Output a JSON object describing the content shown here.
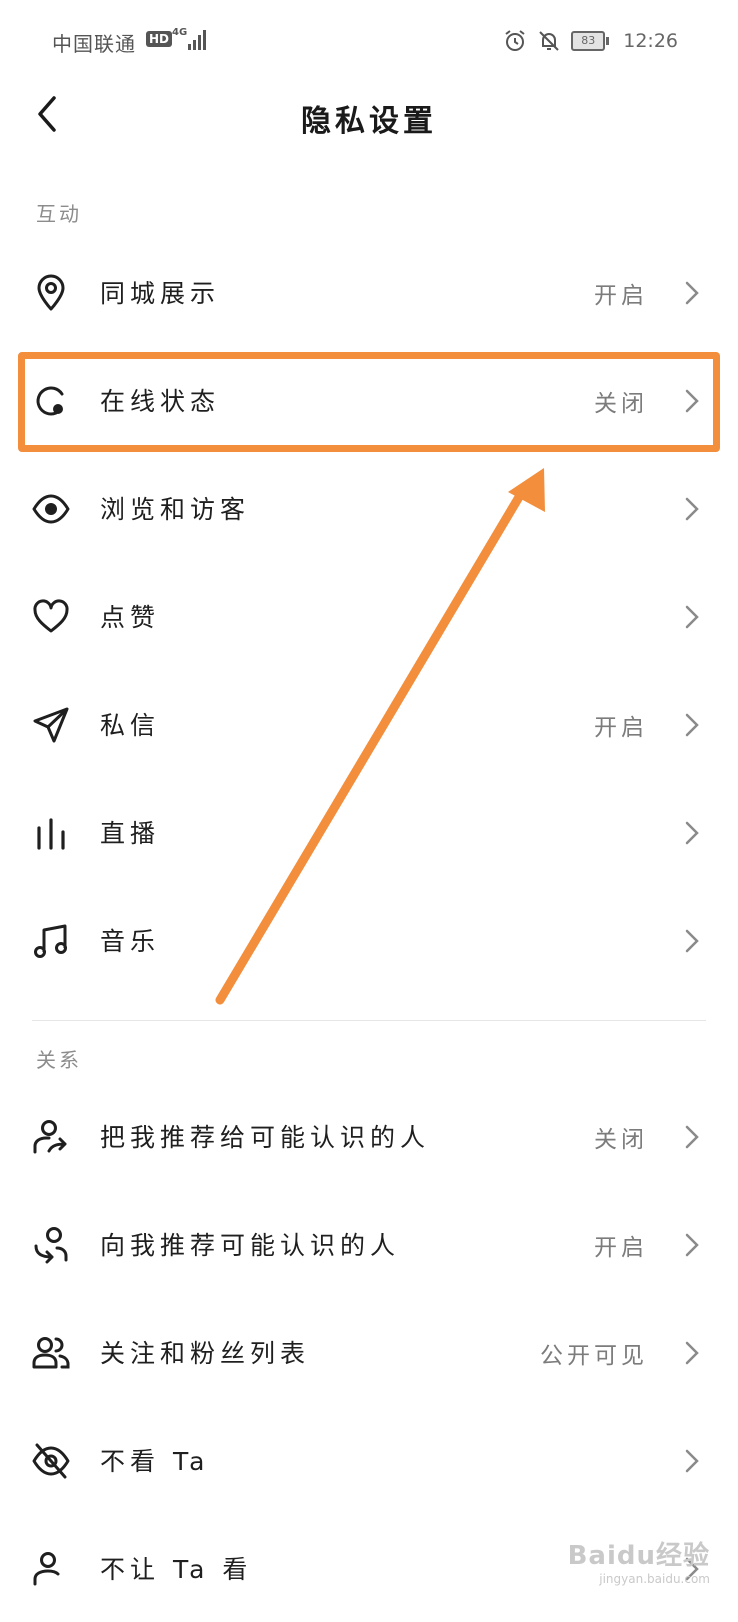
{
  "status_bar": {
    "carrier": "中国联通",
    "hd_badge": "HD",
    "network": "4G",
    "battery": "83",
    "time": "12:26"
  },
  "header": {
    "title": "隐私设置"
  },
  "sections": [
    {
      "label": "互动",
      "rows": [
        {
          "label": "同城展示",
          "value": "开启",
          "icon": "location-pin-icon"
        },
        {
          "label": "在线状态",
          "value": "关闭",
          "icon": "online-status-icon"
        },
        {
          "label": "浏览和访客",
          "value": "",
          "icon": "eye-icon"
        },
        {
          "label": "点赞",
          "value": "",
          "icon": "heart-icon"
        },
        {
          "label": "私信",
          "value": "开启",
          "icon": "paper-plane-icon"
        },
        {
          "label": "直播",
          "value": "",
          "icon": "bars-icon"
        },
        {
          "label": "音乐",
          "value": "",
          "icon": "music-note-icon"
        }
      ]
    },
    {
      "label": "关系",
      "rows": [
        {
          "label": "把我推荐给可能认识的人",
          "value": "关闭",
          "icon": "user-share-icon"
        },
        {
          "label": "向我推荐可能认识的人",
          "value": "开启",
          "icon": "user-recommend-icon"
        },
        {
          "label": "关注和粉丝列表",
          "value": "公开可见",
          "icon": "users-icon"
        },
        {
          "label": "不看 Ta",
          "value": "",
          "icon": "eye-off-icon"
        },
        {
          "label": "不让 Ta 看",
          "value": "",
          "icon": "user-block-icon"
        }
      ]
    }
  ],
  "watermark": {
    "main": "Baidu经验",
    "sub": "jingyan.baidu.com"
  },
  "colors": {
    "highlight": "#f28e3c",
    "text": "#1f1f1f",
    "secondary": "#7c7c7c"
  }
}
